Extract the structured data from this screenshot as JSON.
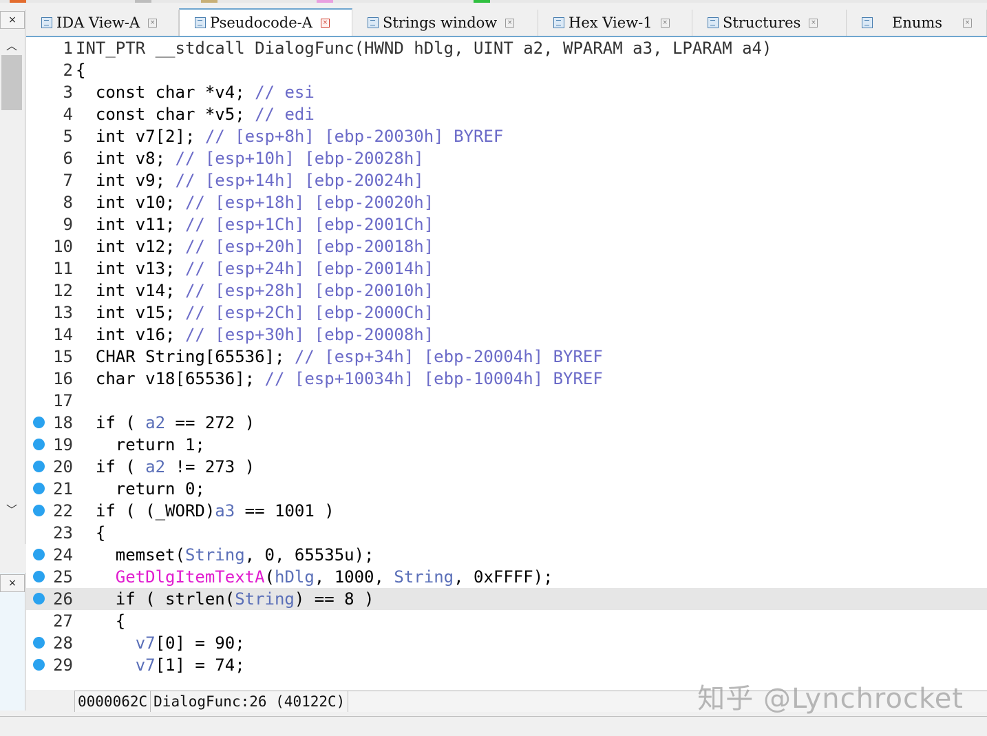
{
  "tabs": [
    {
      "label": "IDA View-A",
      "active": false
    },
    {
      "label": "Pseudocode-A",
      "active": true
    },
    {
      "label": "Strings window",
      "active": false
    },
    {
      "label": "Hex View-1",
      "active": false
    },
    {
      "label": "Structures",
      "active": false
    },
    {
      "label": "Enums",
      "active": false
    }
  ],
  "left_panel": {
    "close_glyph": "×",
    "close_glyph_2": "×",
    "scroll_up": "︿",
    "scroll_down": "﹀"
  },
  "code_lines": [
    {
      "n": "1",
      "text": "INT_PTR __stdcall DialogFunc(HWND hDlg, UINT a2, WPARAM a3, LPARAM a4)",
      "bp": false
    },
    {
      "n": "2",
      "text": "{",
      "bp": false
    },
    {
      "n": "3",
      "text": "  const char *v4; // esi",
      "bp": false
    },
    {
      "n": "4",
      "text": "  const char *v5; // edi",
      "bp": false
    },
    {
      "n": "5",
      "text": "  int v7[2]; // [esp+8h] [ebp-20030h] BYREF",
      "bp": false
    },
    {
      "n": "6",
      "text": "  int v8; // [esp+10h] [ebp-20028h]",
      "bp": false
    },
    {
      "n": "7",
      "text": "  int v9; // [esp+14h] [ebp-20024h]",
      "bp": false
    },
    {
      "n": "8",
      "text": "  int v10; // [esp+18h] [ebp-20020h]",
      "bp": false
    },
    {
      "n": "9",
      "text": "  int v11; // [esp+1Ch] [ebp-2001Ch]",
      "bp": false
    },
    {
      "n": "10",
      "text": "  int v12; // [esp+20h] [ebp-20018h]",
      "bp": false
    },
    {
      "n": "11",
      "text": "  int v13; // [esp+24h] [ebp-20014h]",
      "bp": false
    },
    {
      "n": "12",
      "text": "  int v14; // [esp+28h] [ebp-20010h]",
      "bp": false
    },
    {
      "n": "13",
      "text": "  int v15; // [esp+2Ch] [ebp-2000Ch]",
      "bp": false
    },
    {
      "n": "14",
      "text": "  int v16; // [esp+30h] [ebp-20008h]",
      "bp": false
    },
    {
      "n": "15",
      "text": "  CHAR String[65536]; // [esp+34h] [ebp-20004h] BYREF",
      "bp": false
    },
    {
      "n": "16",
      "text": "  char v18[65536]; // [esp+10034h] [ebp-10004h] BYREF",
      "bp": false
    },
    {
      "n": "17",
      "text": "",
      "bp": false
    },
    {
      "n": "18",
      "text": "  if ( a2 == 272 )",
      "bp": true
    },
    {
      "n": "19",
      "text": "    return 1;",
      "bp": true
    },
    {
      "n": "20",
      "text": "  if ( a2 != 273 )",
      "bp": true
    },
    {
      "n": "21",
      "text": "    return 0;",
      "bp": true
    },
    {
      "n": "22",
      "text": "  if ( (_WORD)a3 == 1001 )",
      "bp": true
    },
    {
      "n": "23",
      "text": "  {",
      "bp": false
    },
    {
      "n": "24",
      "text": "    memset(String, 0, 65535u);",
      "bp": true
    },
    {
      "n": "25",
      "text": "    GetDlgItemTextA(hDlg, 1000, String, 0xFFFF);",
      "bp": true
    },
    {
      "n": "26",
      "text": "    if ( strlen(String) == 8 )",
      "bp": true,
      "current": true
    },
    {
      "n": "27",
      "text": "    {",
      "bp": false
    },
    {
      "n": "28",
      "text": "      v7[0] = 90;",
      "bp": true
    },
    {
      "n": "29",
      "text": "      v7[1] = 74;",
      "bp": true
    }
  ],
  "status": {
    "address": "0000062C",
    "location": "DialogFunc:26 (40122C)"
  },
  "watermark": "知乎 @Lynchrocket",
  "colors": {
    "comment": "#6b6bc8",
    "function_call": "#e01ccf",
    "breakpoint": "#2aa2ef",
    "tab_accent": "#6fa6cf"
  }
}
